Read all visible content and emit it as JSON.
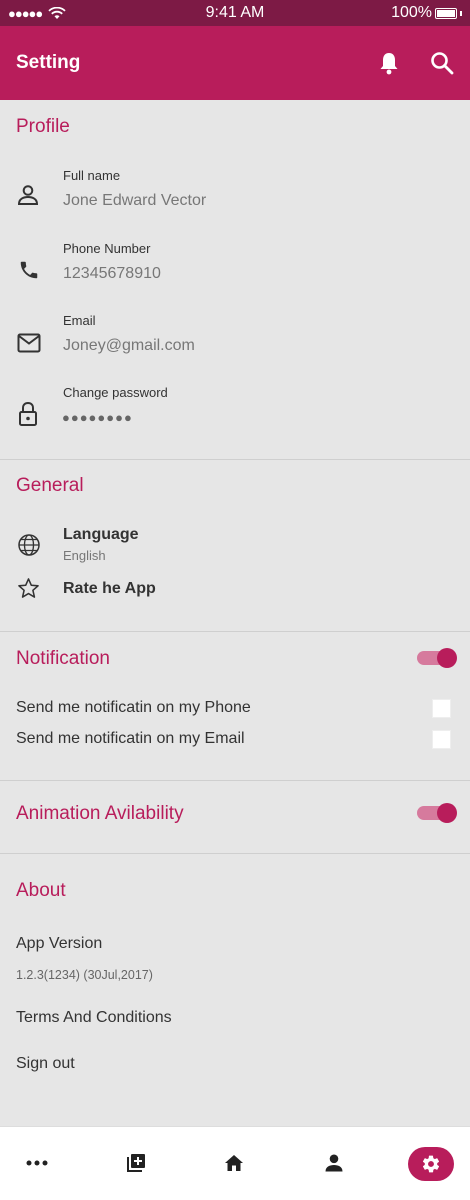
{
  "status_bar": {
    "signal": "●●●●●",
    "time": "9:41 AM",
    "battery": "100%"
  },
  "app_bar": {
    "title": "Setting"
  },
  "profile": {
    "title": "Profile",
    "fields": [
      {
        "label": "Full name",
        "value": "Jone Edward Vector",
        "icon": "person-icon"
      },
      {
        "label": "Phone Number",
        "value": "12345678910",
        "icon": "phone-icon"
      },
      {
        "label": "Email",
        "value": "Joney@gmail.com",
        "icon": "mail-icon"
      },
      {
        "label": "Change password",
        "value": "●●●●●●●●",
        "icon": "lock-icon"
      }
    ]
  },
  "general": {
    "title": "General",
    "language_label": "Language",
    "language_value": "English",
    "rate_label": "Rate he App"
  },
  "notification": {
    "title": "Notification",
    "enabled": true,
    "phone_label": "Send me notificatin on my Phone",
    "phone_checked": false,
    "email_label": "Send me notificatin on my Email",
    "email_checked": false
  },
  "animation": {
    "title": "Animation Avilability",
    "enabled": true
  },
  "about": {
    "title": "About",
    "version_label": "App Version",
    "version_value": "1.2.3(1234) (30Jul,2017)",
    "terms_label": "Terms And Conditions",
    "signout_label": "Sign out"
  },
  "bottom_nav": {
    "items": [
      "more-icon",
      "add-library-icon",
      "home-icon",
      "account-icon",
      "settings-icon"
    ],
    "active": "settings-icon"
  },
  "colors": {
    "primary": "#b81d5b",
    "status_bar": "#7d1a45",
    "background": "#e6e6e6"
  }
}
